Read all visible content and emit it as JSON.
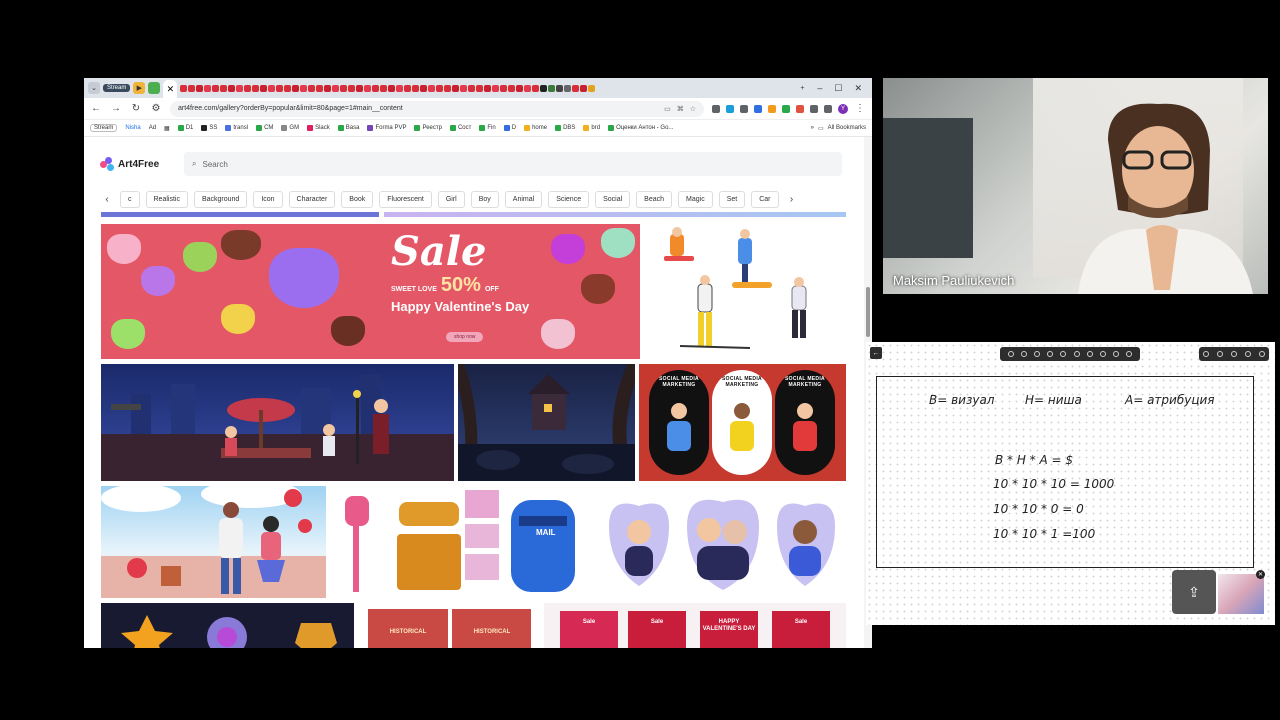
{
  "browser": {
    "tab_stream_label": "Stream",
    "tab_close": "✕",
    "new_tab": "+",
    "window_controls": [
      "–",
      "☐",
      "✕"
    ],
    "url": "art4free.com/gallery?orderBy=popular&limit=80&page=1#main__content",
    "profile_initial": "Y",
    "bookmarks": [
      "Stream",
      "Nisha",
      "Ad",
      "D1",
      "SS",
      "transl",
      "CM",
      "GM",
      "Slack",
      "Basa",
      "Forma PVP",
      "Реестр",
      "Сост",
      "Fin",
      "D",
      "home",
      "DBS",
      "brd",
      "Оценки Антон - Go..."
    ],
    "bookmarks_more": "»",
    "all_bookmarks": "All Bookmarks"
  },
  "site": {
    "brand": "Art4Free",
    "search_placeholder": "Search",
    "categories": [
      "c",
      "Realistic",
      "Background",
      "Icon",
      "Character",
      "Book",
      "Fluorescent",
      "Girl",
      "Boy",
      "Animal",
      "Science",
      "Social",
      "Beach",
      "Magic",
      "Set",
      "Car"
    ],
    "valentine": {
      "sale": "Sale",
      "sweet_love": "SWEET LOVE",
      "percent": "50%",
      "off": "OFF",
      "title": "Happy Valentine's Day",
      "shop_now": "shop now"
    },
    "smm_label": "SOCIAL MEDIA MARKETING",
    "historical_label": "HISTORICAL",
    "happy_valentines": "HAPPY VALENTINE'S DAY",
    "sale_short": "Sale"
  },
  "webcam": {
    "name": "Maksim Pauliukevich"
  },
  "whiteboard": {
    "line1_b": "B= визуал",
    "line1_h": "H= ниша",
    "line1_a": "A= атрибуция",
    "formula": "B * H * A = $",
    "calc1": "10 * 10 * 10 = 1000",
    "calc2": "10 * 10 * 0 = 0",
    "calc3": "10 * 10 * 1 =100"
  },
  "colors": {
    "valentine_bg": "#e45766",
    "smm_bg": "#c5392f",
    "brand_purple": "#7a2fb6"
  }
}
